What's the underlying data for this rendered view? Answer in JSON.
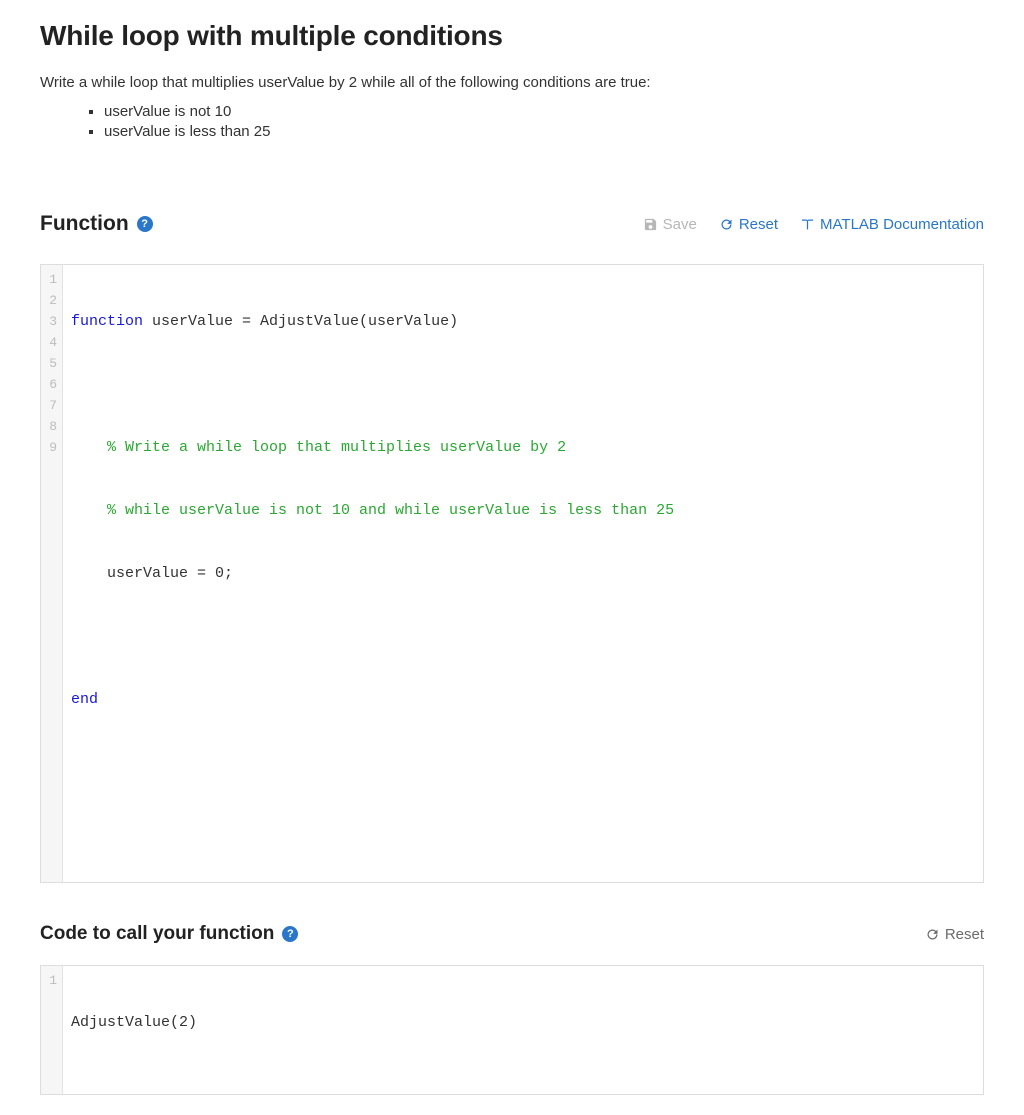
{
  "page": {
    "title": "While loop with multiple conditions",
    "instructions": "Write a while loop that multiplies userValue by 2 while all of the following conditions are true:",
    "conditions": [
      "userValue is not 10",
      "userValue is less than 25"
    ]
  },
  "function_section": {
    "title": "Function",
    "help_glyph": "?",
    "toolbar": {
      "save_label": "Save",
      "reset_label": "Reset",
      "doc_label": "MATLAB Documentation"
    },
    "code": {
      "line1_kw": "function",
      "line1_rest": " userValue = AdjustValue(userValue)",
      "line2": "",
      "line3": "    % Write a while loop that multiplies userValue by 2",
      "line4": "    % while userValue is not 10 and while userValue is less than 25",
      "line5": "    userValue = 0;",
      "line6": "",
      "line7": "end",
      "line8": "",
      "line9": "",
      "gutter": [
        "1",
        "2",
        "3",
        "4",
        "5",
        "6",
        "7",
        "8",
        "9"
      ]
    }
  },
  "call_section": {
    "title": "Code to call your function",
    "help_glyph": "?",
    "reset_label": "Reset",
    "code": {
      "line1": "AdjustValue(2)",
      "gutter": [
        "1"
      ]
    }
  },
  "colors": {
    "link": "#2a77c9",
    "disabled": "#b6b6b6",
    "comment": "#2aa832",
    "keyword": "#1818d8"
  }
}
